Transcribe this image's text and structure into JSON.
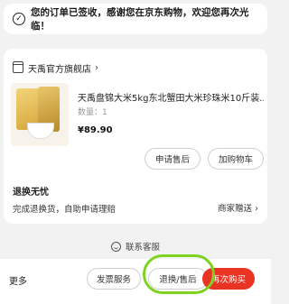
{
  "status": {
    "message": "您的订单已签收，感谢您在京东购物，欢迎您再次光临！"
  },
  "store": {
    "name": "天禹官方旗舰店",
    "chevron": "›"
  },
  "product": {
    "title": "天禹盘锦大米5kg东北蟹田大米珍珠米10斤装...",
    "quantity": "数量：1",
    "price": "¥89.90"
  },
  "product_actions": {
    "after_sale": "申请售后",
    "add_cart": "加购物车"
  },
  "hassle_free": {
    "title": "退换无忧",
    "desc": "完成退换货，自助申请理赔",
    "right_link": "商家赠送",
    "right_chevron": "›"
  },
  "service": {
    "label": "联系客服"
  },
  "bottom_bar": {
    "more": "更多",
    "invoice": "发票服务",
    "return": "退换/售后",
    "rebuy": "再次购买"
  },
  "colors": {
    "accent_red": "#e93323",
    "highlight_green": "#7ed321"
  }
}
